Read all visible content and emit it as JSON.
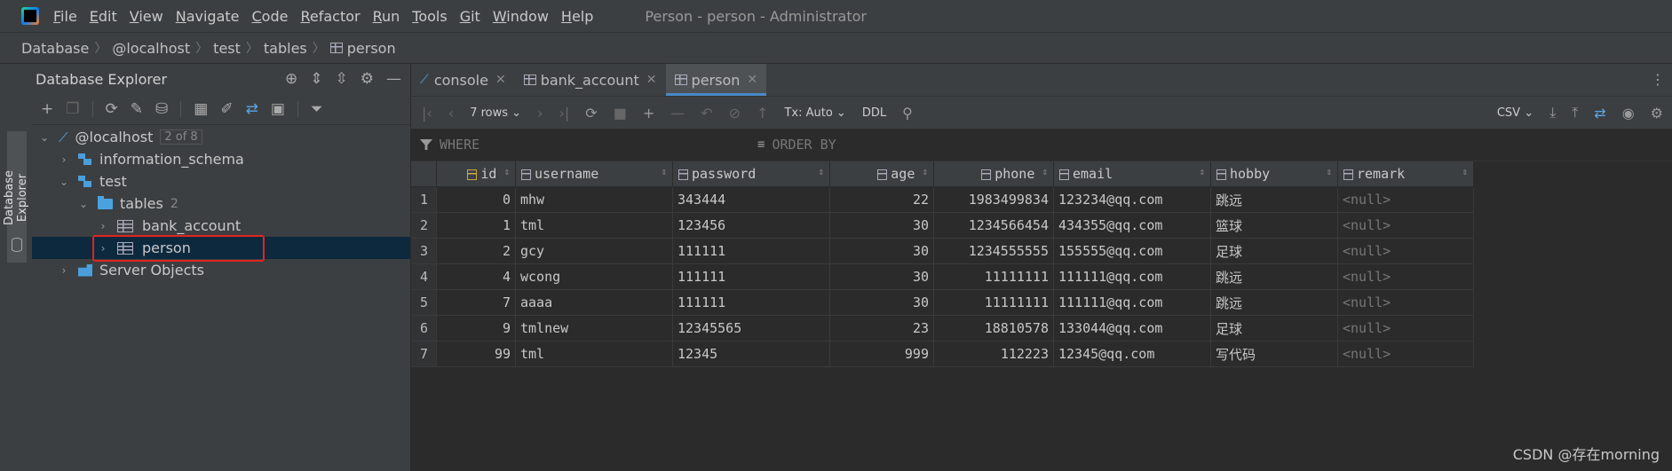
{
  "menu": {
    "items": [
      "File",
      "Edit",
      "View",
      "Navigate",
      "Code",
      "Refactor",
      "Run",
      "Tools",
      "Git",
      "Window",
      "Help"
    ],
    "window_title": "Person - person - Administrator"
  },
  "breadcrumb": [
    "Database",
    "@localhost",
    "test",
    "tables",
    "person"
  ],
  "side_tab": {
    "label": "Database Explorer"
  },
  "explorer": {
    "title": "Database Explorer",
    "tree": {
      "host": "@localhost",
      "host_count": "2 of 8",
      "schema1": "information_schema",
      "schema2": "test",
      "tables_folder": "tables",
      "tables_count": "2",
      "table1": "bank_account",
      "table2": "person",
      "server_objects": "Server Objects"
    }
  },
  "tabs": [
    {
      "label": "console"
    },
    {
      "label": "bank_account"
    },
    {
      "label": "person",
      "active": true
    }
  ],
  "toolbar": {
    "rows": "7 rows",
    "tx": "Tx: Auto",
    "ddl": "DDL",
    "export_format": "CSV"
  },
  "filter": {
    "where": "WHERE",
    "order_by": "ORDER BY"
  },
  "table": {
    "columns": [
      "id",
      "username",
      "password",
      "age",
      "phone",
      "email",
      "hobby",
      "remark"
    ],
    "rows": [
      [
        "1",
        "0",
        "mhw",
        "343444",
        "22",
        "1983499834",
        "123234@qq.com",
        "跳远",
        "<null>"
      ],
      [
        "2",
        "1",
        "tml",
        "123456",
        "30",
        "1234566454",
        "434355@qq.com",
        "篮球",
        "<null>"
      ],
      [
        "3",
        "2",
        "gcy",
        "111111",
        "30",
        "1234555555",
        "155555@qq.com",
        "足球",
        "<null>"
      ],
      [
        "4",
        "4",
        "wcong",
        "111111",
        "30",
        "11111111",
        "111111@qq.com",
        "跳远",
        "<null>"
      ],
      [
        "5",
        "7",
        "aaaa",
        "111111",
        "30",
        "11111111",
        "111111@qq.com",
        "跳远",
        "<null>"
      ],
      [
        "6",
        "9",
        "tmlnew",
        "12345565",
        "23",
        "18810578",
        "133044@qq.com",
        "足球",
        "<null>"
      ],
      [
        "7",
        "99",
        "tml",
        "12345",
        "999",
        "112223",
        "12345@qq.com",
        "写代码",
        "<null>"
      ]
    ]
  },
  "watermark": "CSDN @存在morning"
}
